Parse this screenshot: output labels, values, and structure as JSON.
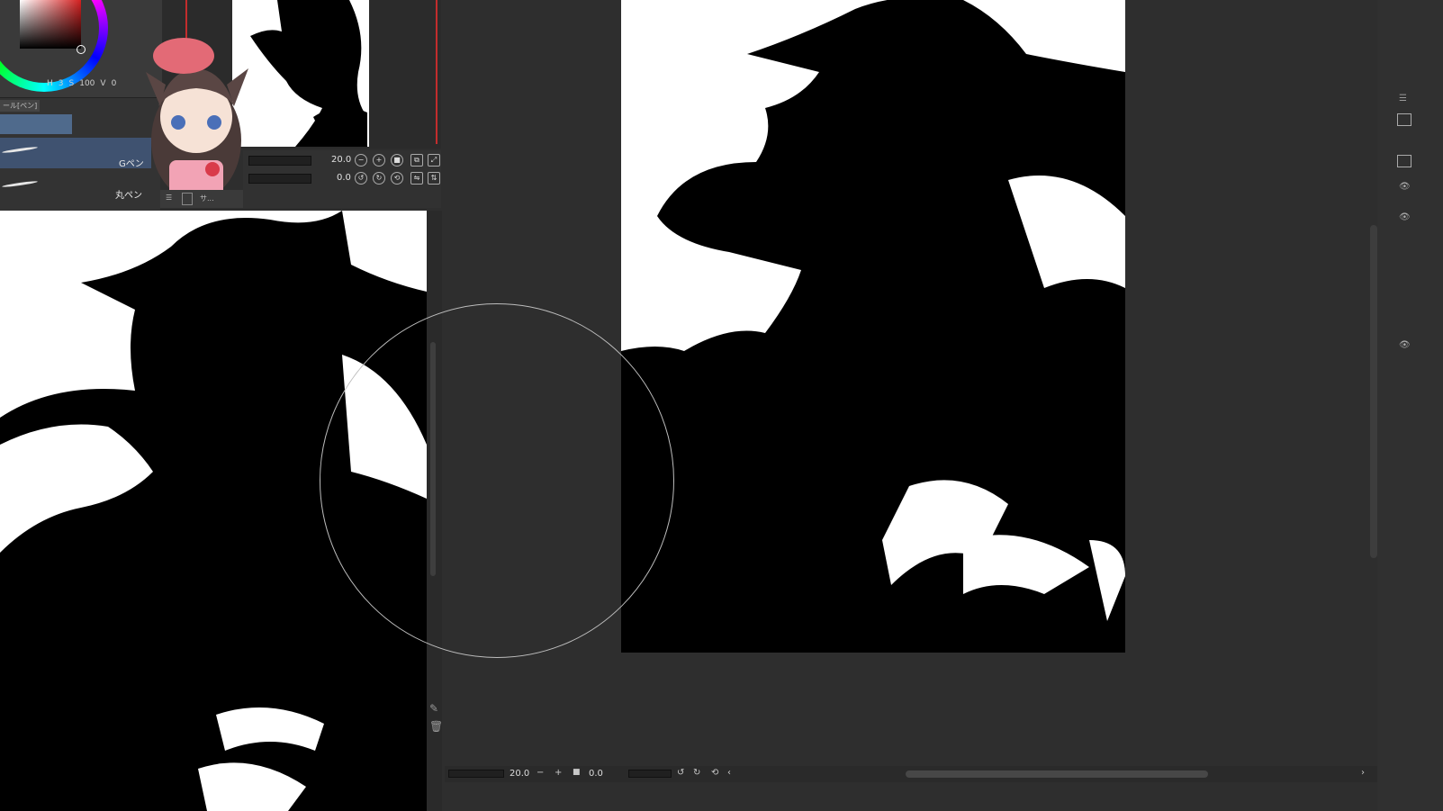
{
  "color_panel": {
    "hsv_h": "H",
    "hsv_s": "3",
    "hsv_s_label": "S",
    "hsv_v": "100",
    "hsv_v_label": "V",
    "extra": "0"
  },
  "tool_panel": {
    "title": "ール[ペン]",
    "brushes": [
      {
        "label": "Gペン"
      },
      {
        "label": "丸ペン"
      }
    ]
  },
  "navigator": {
    "zoom": "20.0",
    "rotation": "0.0",
    "tab_label": "サ..."
  },
  "status": {
    "zoom": "20.0",
    "rotation": "0.0"
  },
  "colors": {
    "canvas_bg": "#ffffff",
    "workspace": "#2e2e2e",
    "accent_red": "#c32d2d"
  }
}
